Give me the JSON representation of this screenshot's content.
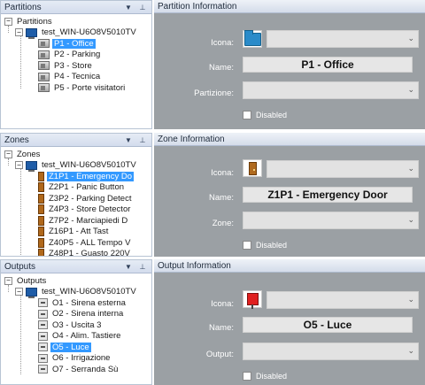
{
  "partitions": {
    "tree": {
      "title": "Partitions",
      "root": "Partitions",
      "computer": "test_WIN-U6O8V5010TV",
      "items": [
        "P1 - Office",
        "P2 - Parking",
        "P3 - Store",
        "P4 - Tecnica",
        "P5 - Porte visitatori"
      ],
      "selected_index": 0
    },
    "info": {
      "title": "Partition Information",
      "icon_label": "Icona:",
      "name_label": "Name:",
      "name_value": "P1 - Office",
      "combo_label": "Partizione:",
      "disabled_label": "Disabled"
    }
  },
  "zones": {
    "tree": {
      "title": "Zones",
      "root": "Zones",
      "computer": "test_WIN-U6O8V5010TV",
      "items": [
        "Z1P1 - Emergency Do",
        "Z2P1 - Panic Button",
        "Z3P2 - Parking Detect",
        "Z4P3 - Store Detector",
        "Z7P2 - Marciapiedi D",
        "Z16P1 - Att Tast",
        "Z40P5 - ALL Tempo V",
        "Z48P1 - Guasto 220V"
      ],
      "selected_index": 0
    },
    "info": {
      "title": "Zone Information",
      "icon_label": "Icona:",
      "name_label": "Name:",
      "name_value": "Z1P1 - Emergency Door",
      "combo_label": "Zone:",
      "disabled_label": "Disabled"
    }
  },
  "outputs": {
    "tree": {
      "title": "Outputs",
      "root": "Outputs",
      "computer": "test_WIN-U6O8V5010TV",
      "items": [
        "O1 - Sirena esterna",
        "O2 - Sirena interna",
        "O3 - Uscita  3",
        "O4 - Alim. Tastiere",
        "O5 - Luce",
        "O6 - Irrigazione",
        "O7 - Serranda Sù"
      ],
      "selected_index": 4
    },
    "info": {
      "title": "Output Information",
      "icon_label": "Icona:",
      "name_label": "Name:",
      "name_value": "O5 - Luce",
      "combo_label": "Output:",
      "disabled_label": "Disabled"
    }
  },
  "header_buttons": {
    "dropdown_glyph": "▼",
    "pin_glyph": "⊥"
  },
  "glyphs": {
    "collapse": "−",
    "combo_arrow": "⌄"
  },
  "colors": {
    "selection": "#3399ff",
    "info_bg": "#9ba0a4",
    "tree_header": "#d3dced"
  }
}
